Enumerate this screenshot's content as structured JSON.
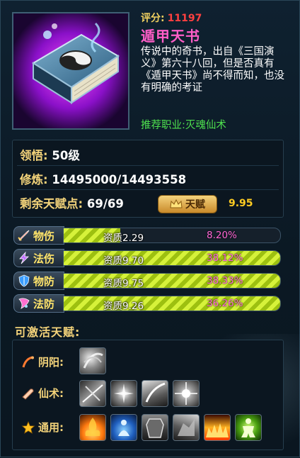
{
  "item": {
    "score_label": "评分:",
    "score_value": "11197",
    "name": "遁甲天书",
    "description": "传说中的奇书，出自《三国演义》第六十八回，但是否真有《遁甲天书》尚不得而知，也没有明确的考证",
    "recommend": "推荐职业:灭魂仙术"
  },
  "stats": {
    "comprehension_label": "领悟",
    "comprehension_value": "50级",
    "cultivation_label": "修炼",
    "cultivation_value": "14495000/14493558",
    "remaining_label": "剩余天赋点",
    "remaining_value": "69/69",
    "talent_button": "天赋",
    "talent_score": "9.95"
  },
  "bars": [
    {
      "label": "物伤",
      "aptitude": "资质2.29",
      "percent": "8.20%",
      "fill_percent": 26,
      "icon": "sword-icon",
      "color": "#e04030"
    },
    {
      "label": "法伤",
      "aptitude": "资质9.70",
      "percent": "38.12%",
      "fill_percent": 100,
      "icon": "lightning-icon",
      "color": "#c060ff"
    },
    {
      "label": "物防",
      "aptitude": "资质9.75",
      "percent": "38.33%",
      "fill_percent": 100,
      "icon": "shield-icon",
      "color": "#40a0ff"
    },
    {
      "label": "法防",
      "aptitude": "资质9.26",
      "percent": "36.26%",
      "fill_percent": 100,
      "icon": "magic-shield-icon",
      "color": "#ff70d0"
    }
  ],
  "talents": {
    "header": "可激活天赋:",
    "rows": [
      {
        "label": "阴阳:",
        "icon": "yinyang-icon",
        "skills": [
          "vortex-skill-icon"
        ]
      },
      {
        "label": "仙术:",
        "icon": "immortal-art-icon",
        "skills": [
          "shadow-blade-skill-icon",
          "burst-skill-icon",
          "slash-skill-icon",
          "spark-skill-icon"
        ]
      },
      {
        "label": "通用:",
        "icon": "star-icon",
        "skills": [
          "flame-aura-skill-icon",
          "meditate-skill-icon",
          "armor-skill-icon",
          "beast-skill-icon",
          "fire-wall-skill-icon",
          "power-up-skill-icon"
        ]
      }
    ]
  },
  "colors": {
    "score_value": "#ff4040",
    "name": "#ff5ec8",
    "recommend": "#4ee04e",
    "gold_label": "#f3d37a",
    "bar_fill": "#c8e820",
    "percent": "#ff66d6"
  }
}
